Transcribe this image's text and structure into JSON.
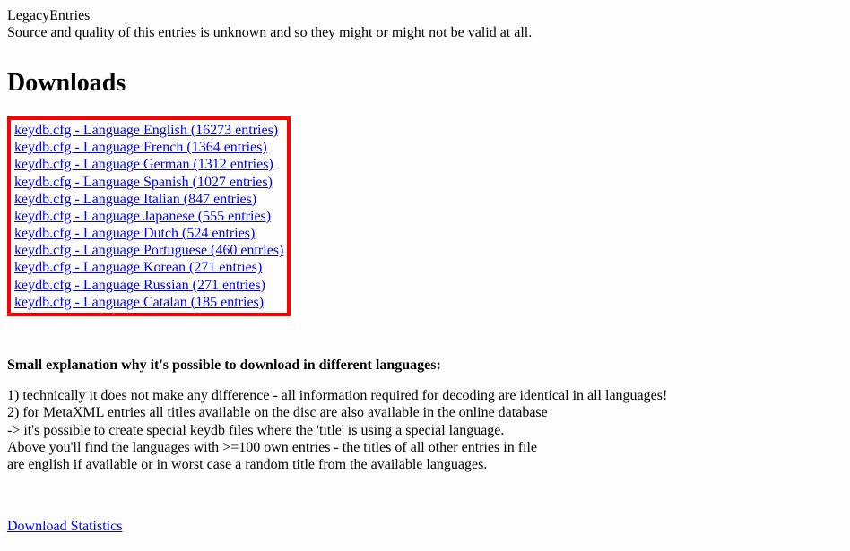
{
  "header": {
    "title": "LegacyEntries",
    "subtitle": "Source and quality of this entries is unknown and so they might or might not be valid at all."
  },
  "downloads_heading": "Downloads",
  "downloads": [
    {
      "label": "keydb.cfg - Language English (16273 entries)"
    },
    {
      "label": "keydb.cfg - Language French (1364 entries)"
    },
    {
      "label": "keydb.cfg - Language German (1312 entries)"
    },
    {
      "label": "keydb.cfg - Language Spanish (1027 entries)"
    },
    {
      "label": "keydb.cfg - Language Italian (847 entries)"
    },
    {
      "label": "keydb.cfg - Language Japanese (555 entries)"
    },
    {
      "label": "keydb.cfg - Language Dutch (524 entries)"
    },
    {
      "label": "keydb.cfg - Language Portuguese (460 entries)"
    },
    {
      "label": "keydb.cfg - Language Korean (271 entries)"
    },
    {
      "label": "keydb.cfg - Language Russian (271 entries)"
    },
    {
      "label": "keydb.cfg - Language Catalan (185 entries)"
    }
  ],
  "explanation_heading": "Small explanation why it's possible to download in different languages:",
  "explanation": {
    "line1": "1) technically it does not make any difference - all information required for decoding are identical in all languages!",
    "line2": "2) for MetaXML entries all titles available on the disc are also available in the online database",
    "line3": "-> it's possible to create special keydb files where the 'title' is using a special language.",
    "line4": "Above you'll find the languages with >=100 own entries - the titles of all other entries in file",
    "line5": "are english if available or in worst case a random title from the available languages."
  },
  "stats_link": "Download Statistics"
}
